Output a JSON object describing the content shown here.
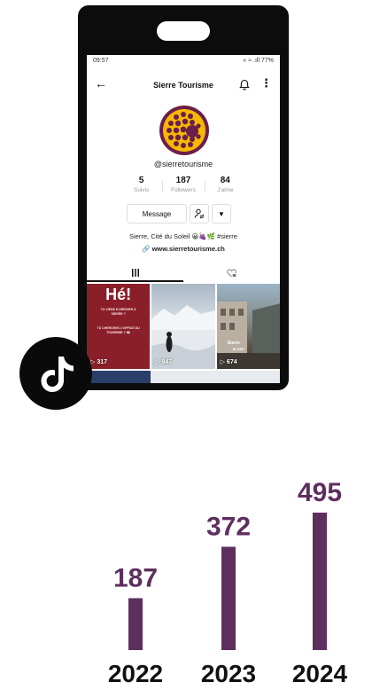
{
  "status_bar": {
    "time": "09:57",
    "indicators": "« ≈ .ıll",
    "battery": "77%"
  },
  "profile": {
    "title": "Sierre Tourisme",
    "handle": "@sierretourisme",
    "stats": [
      {
        "value": "5",
        "label": "Suivis"
      },
      {
        "value": "187",
        "label": "Followers"
      },
      {
        "value": "84",
        "label": "J'aime"
      }
    ],
    "message_label": "Message",
    "bio": "Sierre, Cité du Soleil 😀🍇🌿 #sierre",
    "link": "www.sierretourisme.ch"
  },
  "videos": [
    {
      "views": "317",
      "headline": "Hé!",
      "lines": [
        "TU VIENS D'ARRIVER À",
        "SIERRE ?",
        "TU CHERCHES L'OFFICE DU",
        "TOURISME ? 👀"
      ]
    },
    {
      "views": "947"
    },
    {
      "views": "674",
      "overlay": "Sierre",
      "overlay2": "et ses"
    }
  ],
  "colors": {
    "bar": "#5e2f5e",
    "avatar_ring": "#6b1f4a",
    "avatar_fill": "#f7b800"
  },
  "chart_data": {
    "type": "bar",
    "categories": [
      "2022",
      "2023",
      "2024"
    ],
    "values": [
      187,
      372,
      495
    ],
    "title": "",
    "xlabel": "",
    "ylabel": "",
    "ylim": [
      0,
      495
    ],
    "grid": false
  }
}
